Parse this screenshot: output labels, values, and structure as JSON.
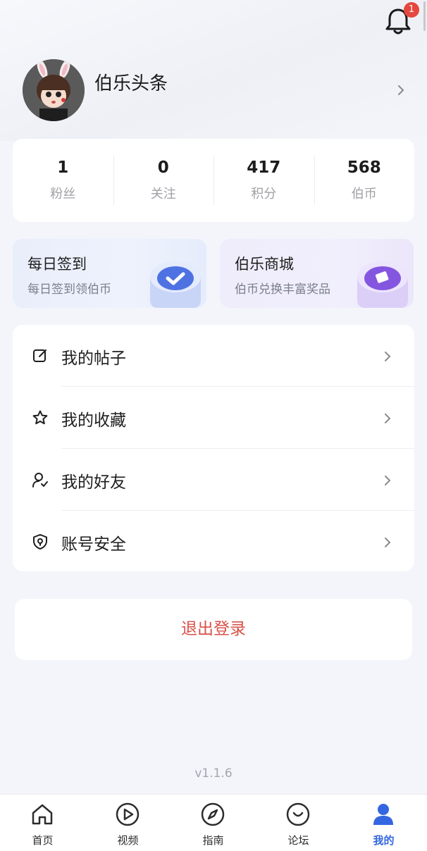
{
  "header": {
    "notification_count": "1"
  },
  "profile": {
    "username": "伯乐头条"
  },
  "stats": [
    {
      "value": "1",
      "label": "粉丝"
    },
    {
      "value": "0",
      "label": "关注"
    },
    {
      "value": "417",
      "label": "积分"
    },
    {
      "value": "568",
      "label": "伯币"
    }
  ],
  "features": {
    "checkin": {
      "title": "每日签到",
      "subtitle": "每日签到领伯币"
    },
    "mall": {
      "title": "伯乐商城",
      "subtitle": "伯币兑换丰富奖品"
    }
  },
  "menu": {
    "items": [
      {
        "label": "我的帖子",
        "icon": "edit-icon"
      },
      {
        "label": "我的收藏",
        "icon": "star-icon"
      },
      {
        "label": "我的好友",
        "icon": "friend-icon"
      },
      {
        "label": "账号安全",
        "icon": "shield-icon"
      }
    ]
  },
  "logout_label": "退出登录",
  "version": "v1.1.6",
  "tabbar": {
    "items": [
      {
        "label": "首页",
        "icon": "home-icon"
      },
      {
        "label": "视频",
        "icon": "play-icon"
      },
      {
        "label": "指南",
        "icon": "compass-icon"
      },
      {
        "label": "论坛",
        "icon": "forum-icon"
      },
      {
        "label": "我的",
        "icon": "user-icon",
        "active": true
      }
    ]
  },
  "colors": {
    "accent": "#3366e0",
    "logout": "#d9514a",
    "badge": "#e5473e",
    "background": "#f3f5fb"
  }
}
